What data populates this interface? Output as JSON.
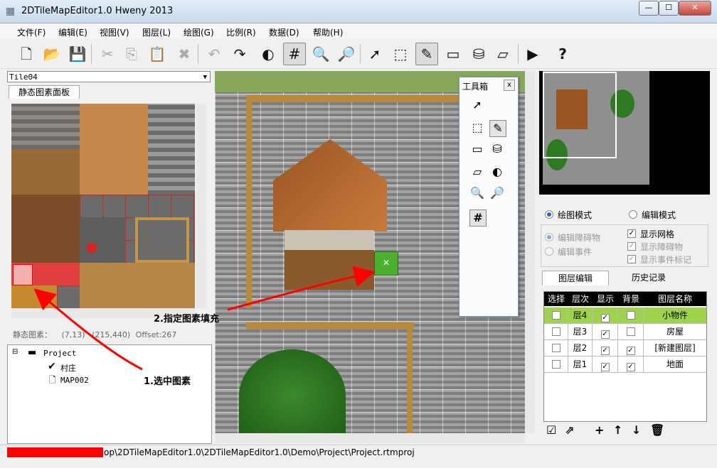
{
  "window": {
    "title": "2DTileMapEditor1.0 Hweny 2013",
    "controls": [
      "—",
      "☐",
      "✕"
    ]
  },
  "menu": [
    "文件(F)",
    "编辑(E)",
    "视图(V)",
    "图层(L)",
    "绘图(G)",
    "比例(R)",
    "数据(D)",
    "帮助(H)"
  ],
  "toolbar": [
    {
      "icon": "new-file-icon",
      "glyph": "🗋"
    },
    {
      "icon": "open-folder-icon",
      "glyph": "📂"
    },
    {
      "icon": "save-icon",
      "glyph": "💾"
    },
    {
      "icon": "cut-icon",
      "glyph": "✂"
    },
    {
      "icon": "copy-icon",
      "glyph": "⎘"
    },
    {
      "icon": "paste-icon",
      "glyph": "📋"
    },
    {
      "icon": "delete-icon",
      "glyph": "✖"
    },
    {
      "icon": "undo-icon",
      "glyph": "↶"
    },
    {
      "icon": "redo-icon",
      "glyph": "↷"
    },
    {
      "icon": "contrast-icon",
      "glyph": "◐"
    },
    {
      "icon": "grid-icon",
      "glyph": "#"
    },
    {
      "icon": "zoom-in-icon",
      "glyph": "🔍"
    },
    {
      "icon": "zoom-out-icon",
      "glyph": "🔎"
    },
    {
      "icon": "select-arrow-icon",
      "glyph": "➚"
    },
    {
      "icon": "marquee-select-icon",
      "glyph": "⬚"
    },
    {
      "icon": "pencil-icon",
      "glyph": "✎"
    },
    {
      "icon": "rectangle-icon",
      "glyph": "▭"
    },
    {
      "icon": "fill-bucket-icon",
      "glyph": "⛁"
    },
    {
      "icon": "eraser-icon",
      "glyph": "▱"
    },
    {
      "icon": "play-icon",
      "glyph": "▶"
    },
    {
      "icon": "help-icon",
      "glyph": "?"
    }
  ],
  "tile_panel": {
    "tileset_name": "Tile04",
    "tab_label": "静态图素面板",
    "status_label": "静态图素：",
    "coords": "(7,13)",
    "pixel": "(215,440)",
    "offset": "Offset:267"
  },
  "project": {
    "root": "Project",
    "child_1": "村庄",
    "child_2": "MAP002"
  },
  "toolbox": {
    "title": "工具箱",
    "close": "x"
  },
  "modes": {
    "draw_mode": "绘图模式",
    "edit_mode": "编辑模式",
    "edit_obstacle": "编辑障碍物",
    "edit_event": "编辑事件",
    "show_grid": "显示网格",
    "show_obstacle": "显示障碍物",
    "show_event_marks": "显示事件标记"
  },
  "layer_panel": {
    "tab_layers": "图层编辑",
    "tab_history": "历史记录",
    "headers": [
      "选择",
      "层次",
      "显示",
      "背景",
      "图层名称"
    ],
    "rows": [
      {
        "level": "层4",
        "shown": true,
        "background": false,
        "name": "小物件",
        "selected": true
      },
      {
        "level": "层3",
        "shown": true,
        "background": false,
        "name": "房屋",
        "selected": false
      },
      {
        "level": "层2",
        "shown": true,
        "background": true,
        "name": "[新建图层]",
        "selected": false
      },
      {
        "level": "层1",
        "shown": true,
        "background": true,
        "name": "地面",
        "selected": false
      }
    ]
  },
  "status": {
    "path": "op\\2DTileMapEditor1.0\\2DTileMapEditor1.0\\Demo\\Project\\Project.rtmproj"
  },
  "annotations": {
    "step1": "1.选中图素",
    "step2": "2.指定图素填充"
  },
  "colors": {
    "selected_row": "#a0d34c",
    "annotation_arrow": "#ff0000",
    "tile_grid": "#ff0000"
  }
}
